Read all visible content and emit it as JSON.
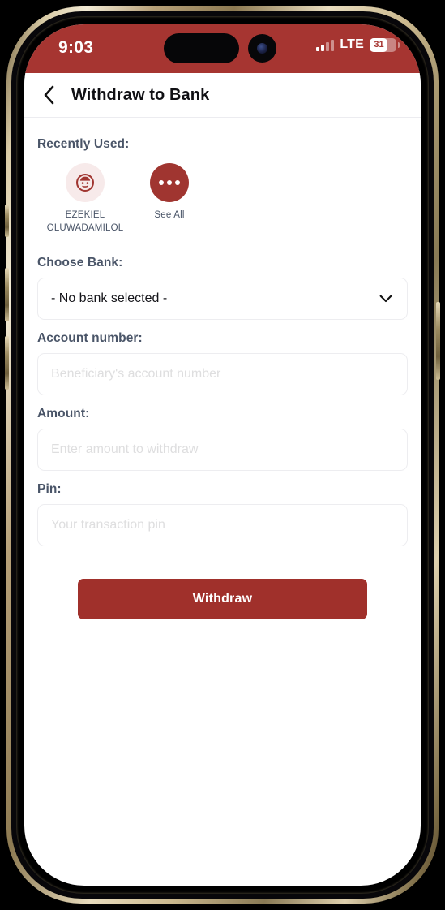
{
  "status_bar": {
    "time": "9:03",
    "network": "LTE",
    "battery_percent": "31"
  },
  "header": {
    "back_icon": "chevron-left-icon",
    "title": "Withdraw to Bank"
  },
  "recently_used": {
    "label": "Recently Used:",
    "items": [
      {
        "name": "EZEKIEL OLUWADAMILOL",
        "icon": "person-face-icon",
        "type": "beneficiary"
      },
      {
        "name": "See All",
        "icon": "ellipsis-icon",
        "type": "see-all"
      }
    ]
  },
  "form": {
    "bank": {
      "label": "Choose Bank:",
      "value": "- No bank selected -",
      "chevron_icon": "chevron-down-icon"
    },
    "account_number": {
      "label": "Account number:",
      "placeholder": "Beneficiary's account number",
      "value": ""
    },
    "amount": {
      "label": "Amount:",
      "placeholder": "Enter amount to withdraw",
      "value": ""
    },
    "pin": {
      "label": "Pin:",
      "placeholder": "Your transaction pin",
      "value": ""
    },
    "submit_label": "Withdraw"
  },
  "colors": {
    "brand_red": "#a63531",
    "button_red": "#a0302b",
    "avatar_bg": "#f7eaea",
    "label_text": "#4a5568",
    "placeholder": "#dededf",
    "border": "#ededf0"
  }
}
